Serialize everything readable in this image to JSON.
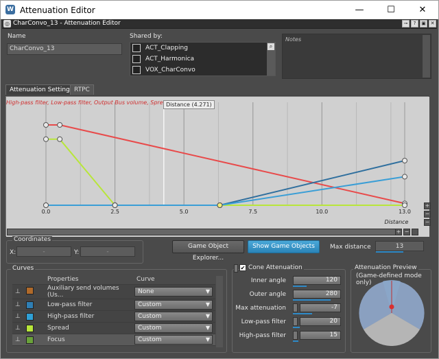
{
  "window": {
    "title": "Attenuation Editor",
    "minimize": "—",
    "maximize": "☐",
    "close": "✕"
  },
  "doc": {
    "title": "CharConvo_13 - Attenuation Editor"
  },
  "name": {
    "label": "Name",
    "value": "CharConvo_13"
  },
  "shared": {
    "label": "Shared by:",
    "items": [
      "ACT_Clapping",
      "ACT_Harmonica",
      "VOX_CharConvo"
    ]
  },
  "notes": {
    "placeholder": "Notes"
  },
  "tabs": [
    "Attenuation Settings",
    "RTPC"
  ],
  "graph": {
    "header": "High-pass filter, Low-pass filter, Output Bus volume, Spread",
    "cursor_label": "Distance (4.271)",
    "x_axis_label": "Distance",
    "ticks": [
      "0.0",
      "2.5",
      "5.0",
      "7.5",
      "10.0",
      "13.0"
    ]
  },
  "chart_data": {
    "type": "line",
    "xlabel": "Distance",
    "xlim": [
      0,
      13
    ],
    "x_ticks": [
      "0.0",
      "2.5",
      "5.0",
      "7.5",
      "10.0",
      "13.0"
    ],
    "grid": true,
    "cursor_x": 4.271,
    "series": [
      {
        "color": "#e84a4a",
        "points": [
          [
            0,
            0.9
          ],
          [
            0.5,
            0.9
          ],
          [
            13,
            0.02
          ]
        ]
      },
      {
        "color": "#b8e63a",
        "points": [
          [
            0,
            0.74
          ],
          [
            0.5,
            0.74
          ],
          [
            2.5,
            0
          ],
          [
            6.3,
            0
          ],
          [
            13,
            0
          ]
        ]
      },
      {
        "color": "#2f6f9e",
        "points": [
          [
            0,
            0
          ],
          [
            2.5,
            0
          ],
          [
            6.3,
            0
          ],
          [
            13,
            0.5
          ]
        ]
      },
      {
        "color": "#3a9ed6",
        "points": [
          [
            0,
            0
          ],
          [
            2.5,
            0
          ],
          [
            6.3,
            0
          ],
          [
            13,
            0.32
          ]
        ]
      }
    ]
  },
  "coordinates": {
    "label": "Coordinates",
    "x_label": "X:",
    "y_label": "Y:",
    "x_value": "-",
    "y_value": "-"
  },
  "buttons": {
    "explorer": "Game Object Explorer...",
    "show": "Show Game Objects"
  },
  "max_distance": {
    "label": "Max distance",
    "value": "13"
  },
  "curves": {
    "label": "Curves",
    "col_properties": "Properties",
    "col_curve": "Curve",
    "rows": [
      {
        "name": "Auxiliary send volumes (Us...",
        "curve": "None",
        "color": "#b06a2a"
      },
      {
        "name": "Low-pass filter",
        "curve": "Custom",
        "color": "#2f7fb5"
      },
      {
        "name": "High-pass filter",
        "curve": "Custom",
        "color": "#2fa0d6"
      },
      {
        "name": "Spread",
        "curve": "Custom",
        "color": "#b8e63a"
      },
      {
        "name": "Focus",
        "curve": "Custom",
        "color": "#6aa23a"
      }
    ]
  },
  "cone": {
    "label": "Cone Attenuation",
    "checked": true,
    "fields": [
      {
        "label": "Inner angle",
        "value": "120"
      },
      {
        "label": "Outer angle",
        "value": "280"
      },
      {
        "label": "Max attenuation",
        "value": "-7"
      },
      {
        "label": "Low-pass filter",
        "value": "20"
      },
      {
        "label": "High-pass filter",
        "value": "15"
      }
    ]
  },
  "preview": {
    "label": "Attenuation Preview",
    "sub": "(Game-defined mode only)"
  }
}
